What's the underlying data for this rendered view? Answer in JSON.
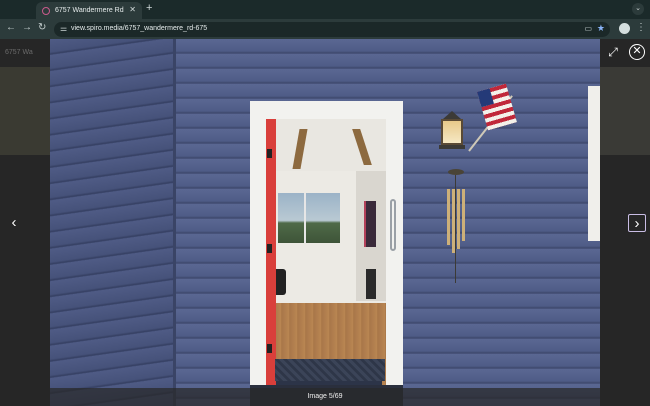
{
  "browser": {
    "tab": {
      "title": "6757 Wandermere Rd",
      "favicon_icon": "spiro-logo-icon",
      "close_icon": "close-icon"
    },
    "new_tab_icon": "plus-icon",
    "tab_menu_icon": "chevron-down-icon",
    "nav": {
      "back_icon": "arrow-left-icon",
      "forward_icon": "arrow-right-icon",
      "reload_icon": "reload-icon"
    },
    "address": {
      "url": "view.spiro.media/6757_wandermere_rd-675",
      "site_info_icon": "tune-icon",
      "cast_icon": "cast-icon",
      "bookmark_icon": "star-icon"
    },
    "profile_icon": "profile-icon",
    "menu_icon": "kebab-menu-icon"
  },
  "viewer": {
    "background_title": "6757 Wa",
    "caption": "Image 5/69",
    "controls": {
      "prev_icon": "chevron-left-icon",
      "next_icon": "chevron-right-icon",
      "fullscreen_icon": "fullscreen-icon",
      "close_icon": "close-circle-icon"
    },
    "colors": {
      "siding": "#4f5c87",
      "door_accent": "#d93f3b",
      "overlay": "#1f1f1f"
    }
  }
}
